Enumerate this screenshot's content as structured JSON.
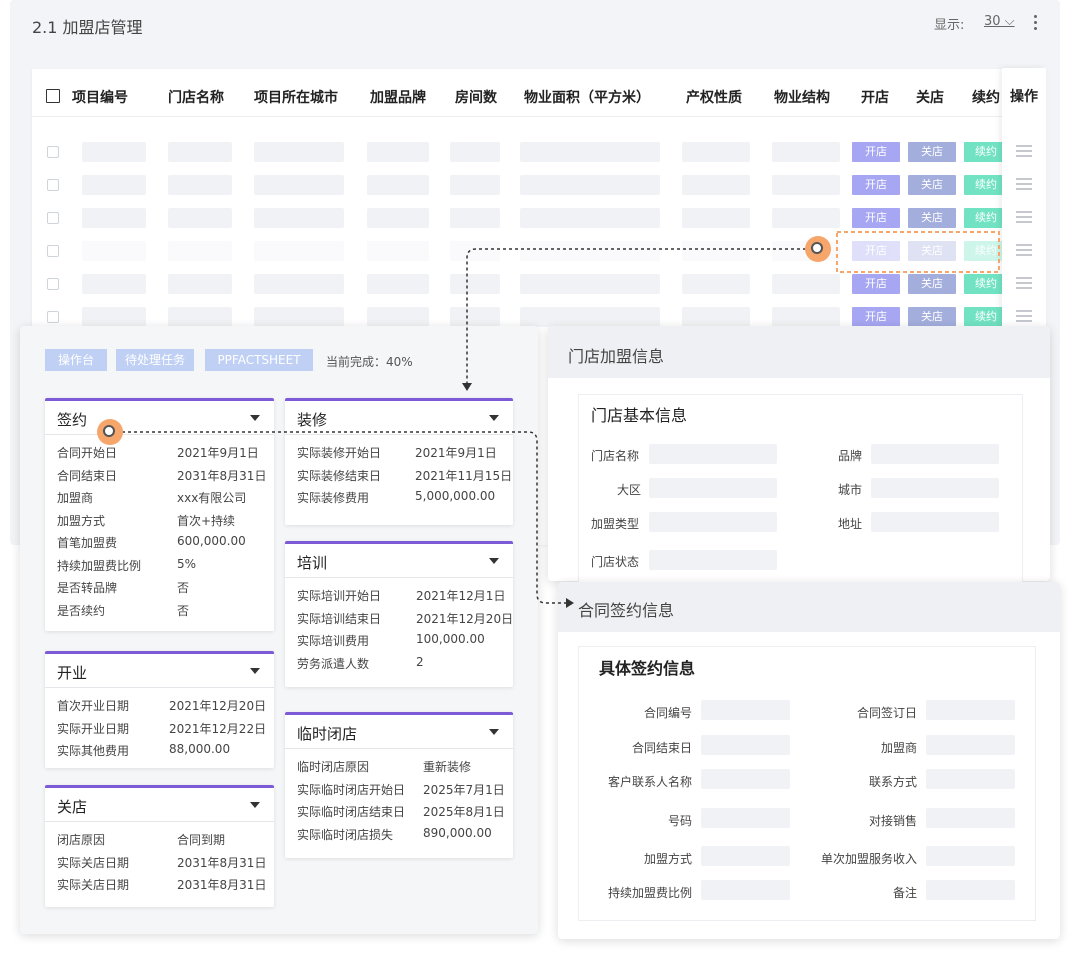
{
  "list": {
    "title": "2.1 加盟店管理",
    "display_label": "显示:",
    "display_value": "30",
    "columns": [
      "项目编号",
      "门店名称",
      "项目所在城市",
      "加盟品牌",
      "房间数",
      "物业面积（平方米）",
      "产权性质",
      "物业结构",
      "开店",
      "关店",
      "续约",
      "操作"
    ],
    "row_actions": {
      "open": "开店",
      "close": "关店",
      "renew": "续约"
    }
  },
  "detail": {
    "pills": [
      "操作台",
      "待处理任务",
      "PPFACTSHEET"
    ],
    "progress": "当前完成：40%",
    "sign": {
      "title": "签约",
      "rows": [
        {
          "label": "合同开始日",
          "value": "2021年9月1日"
        },
        {
          "label": "合同结束日",
          "value": "2031年8月31日"
        },
        {
          "label": "加盟商",
          "value": "xxx有限公司"
        },
        {
          "label": "加盟方式",
          "value": "首次+持续"
        },
        {
          "label": "首笔加盟费",
          "value": "600,000.00"
        },
        {
          "label": "持续加盟费比例",
          "value": "5%"
        },
        {
          "label": "是否转品牌",
          "value": "否"
        },
        {
          "label": "是否续约",
          "value": "否"
        }
      ]
    },
    "renovation": {
      "title": "装修",
      "rows": [
        {
          "label": "实际装修开始日",
          "value": "2021年9月1日"
        },
        {
          "label": "实际装修结束日",
          "value": "2021年11月15日"
        },
        {
          "label": "实际装修费用",
          "value": "5,000,000.00"
        }
      ]
    },
    "training": {
      "title": "培训",
      "rows": [
        {
          "label": "实际培训开始日",
          "value": "2021年12月1日"
        },
        {
          "label": "实际培训结束日",
          "value": "2021年12月20日"
        },
        {
          "label": "实际培训费用",
          "value": "100,000.00"
        },
        {
          "label": "劳务派遣人数",
          "value": "2"
        }
      ]
    },
    "opening": {
      "title": "开业",
      "rows": [
        {
          "label": "首次开业日期",
          "value": "2021年12月20日"
        },
        {
          "label": "实际开业日期",
          "value": "2021年12月22日"
        },
        {
          "label": "实际其他费用",
          "value": "88,000.00"
        }
      ]
    },
    "temp_close": {
      "title": "临时闭店",
      "rows": [
        {
          "label": "临时闭店原因",
          "value": "重新装修"
        },
        {
          "label": "实际临时闭店开始日",
          "value": "2025年7月1日"
        },
        {
          "label": "实际临时闭店结束日",
          "value": "2025年8月1日"
        },
        {
          "label": "实际临时闭店损失",
          "value": "890,000.00"
        }
      ]
    },
    "close": {
      "title": "关店",
      "rows": [
        {
          "label": "闭店原因",
          "value": "合同到期"
        },
        {
          "label": "实际关店日期",
          "value": "2031年8月31日"
        },
        {
          "label": "实际关店日期",
          "value": "2031年8月31日"
        }
      ]
    }
  },
  "store": {
    "title": "门店加盟信息",
    "section": "门店基本信息",
    "fields": {
      "store_name": "门店名称",
      "brand": "品牌",
      "region": "大区",
      "city": "城市",
      "type": "加盟类型",
      "address": "地址",
      "status": "门店状态"
    }
  },
  "contract": {
    "title": "合同签约信息",
    "section": "具体签约信息",
    "fields": {
      "no": "合同编号",
      "sign_date": "合同签订日",
      "end_date": "合同结束日",
      "franchisee": "加盟商",
      "contact": "客户联系人名称",
      "contact_way": "联系方式",
      "number": "号码",
      "sales": "对接销售",
      "method": "加盟方式",
      "income": "单次加盟服务收入",
      "ratio": "持续加盟费比例",
      "remark": "备注"
    }
  },
  "colors": {
    "accent": "#7d5ad6",
    "marker": "#f6a56b",
    "open": "#a6a6f2",
    "close": "#a3aedd",
    "renew": "#71e3c3"
  },
  "icons": {
    "more": "kebab-icon",
    "row_menu": "menu-icon",
    "dropdown": "caret-down-icon"
  }
}
